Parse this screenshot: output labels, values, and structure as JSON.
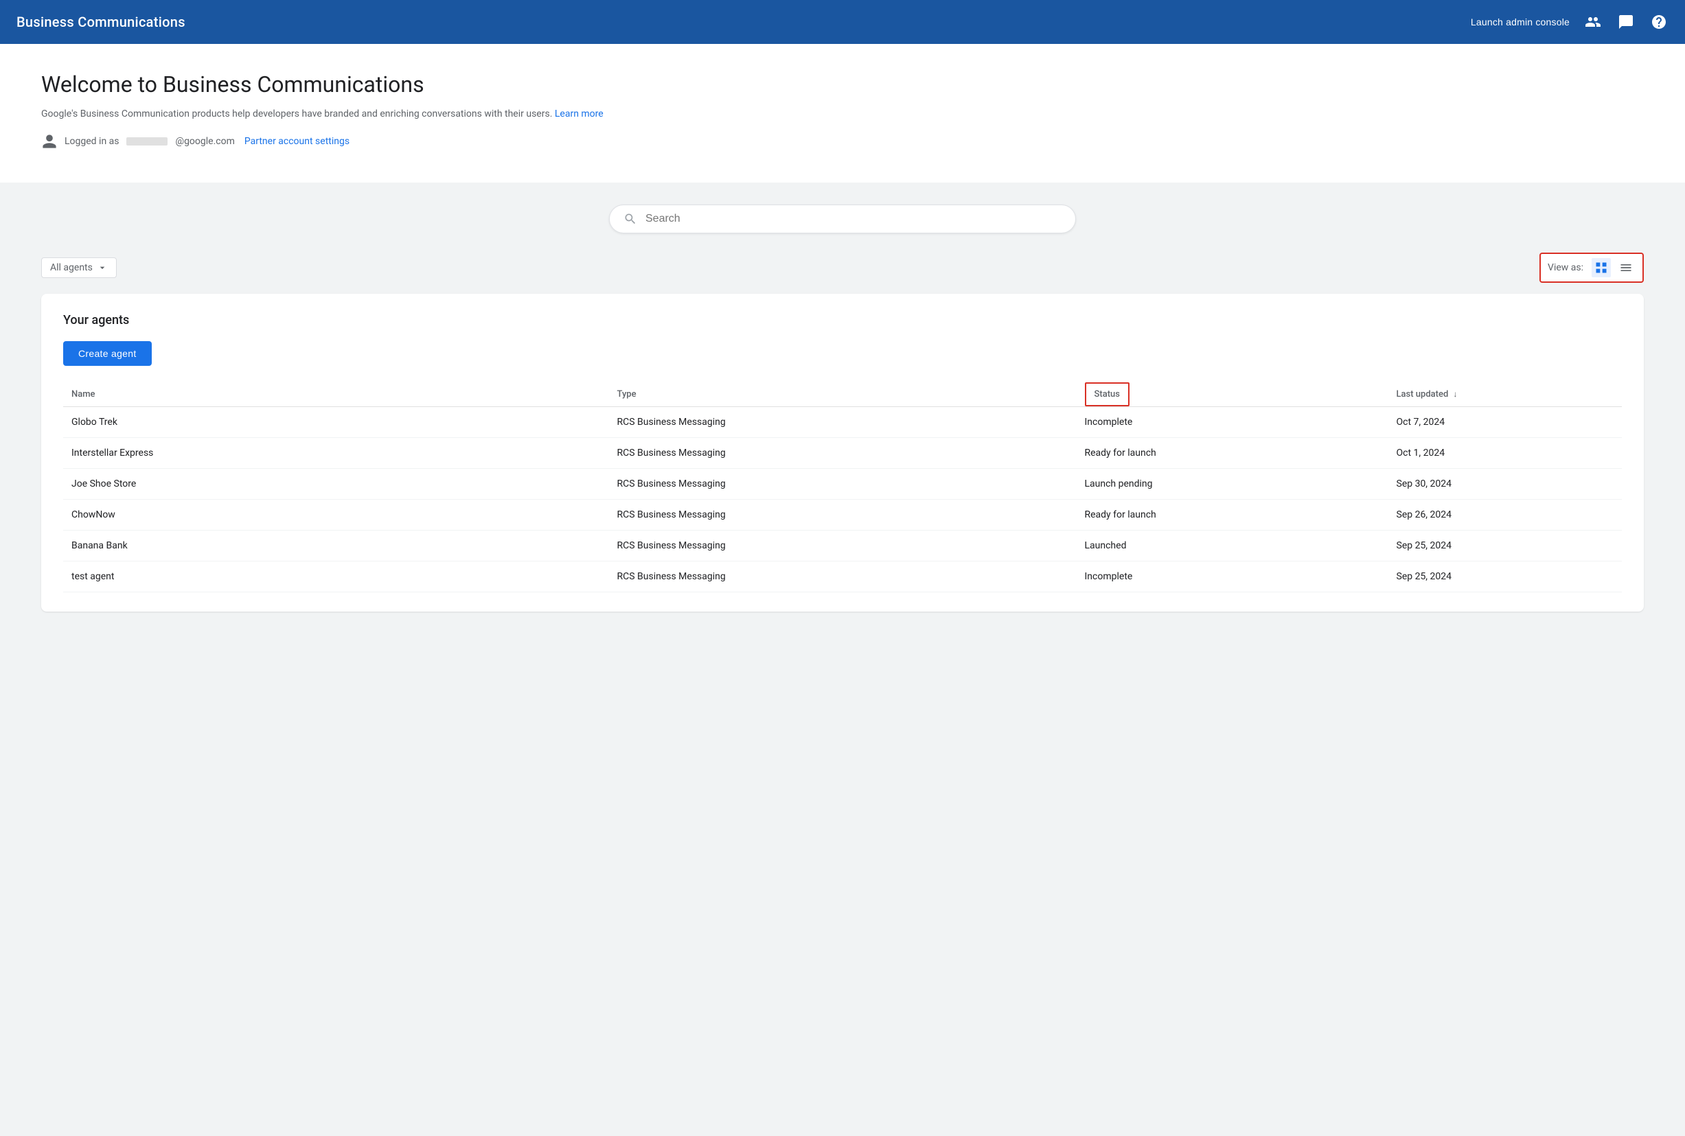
{
  "header": {
    "title": "Business Communications",
    "launch_admin_label": "Launch admin console"
  },
  "welcome": {
    "title": "Welcome to Business Communications",
    "subtitle": "Google's Business Communication products help developers have branded and enriching conversations with their users.",
    "learn_more_label": "Learn more",
    "logged_in_prefix": "Logged in as",
    "email_suffix": "@google.com",
    "partner_settings_label": "Partner account settings"
  },
  "search": {
    "placeholder": "Search"
  },
  "filters": {
    "dropdown_label": "All agents",
    "view_as_label": "View as:"
  },
  "agents_section": {
    "title": "Your agents",
    "create_agent_label": "Create agent",
    "table": {
      "columns": [
        "Name",
        "Type",
        "Status",
        "Last updated"
      ],
      "rows": [
        {
          "name": "Globo Trek",
          "type": "RCS Business Messaging",
          "status": "Incomplete",
          "updated": "Oct 7, 2024"
        },
        {
          "name": "Interstellar Express",
          "type": "RCS Business Messaging",
          "status": "Ready for launch",
          "updated": "Oct 1, 2024"
        },
        {
          "name": "Joe Shoe Store",
          "type": "RCS Business Messaging",
          "status": "Launch pending",
          "updated": "Sep 30, 2024"
        },
        {
          "name": "ChowNow",
          "type": "RCS Business Messaging",
          "status": "Ready for launch",
          "updated": "Sep 26, 2024"
        },
        {
          "name": "Banana Bank",
          "type": "RCS Business Messaging",
          "status": "Launched",
          "updated": "Sep 25, 2024"
        },
        {
          "name": "test agent",
          "type": "RCS Business Messaging",
          "status": "Incomplete",
          "updated": "Sep 25, 2024"
        }
      ]
    }
  }
}
